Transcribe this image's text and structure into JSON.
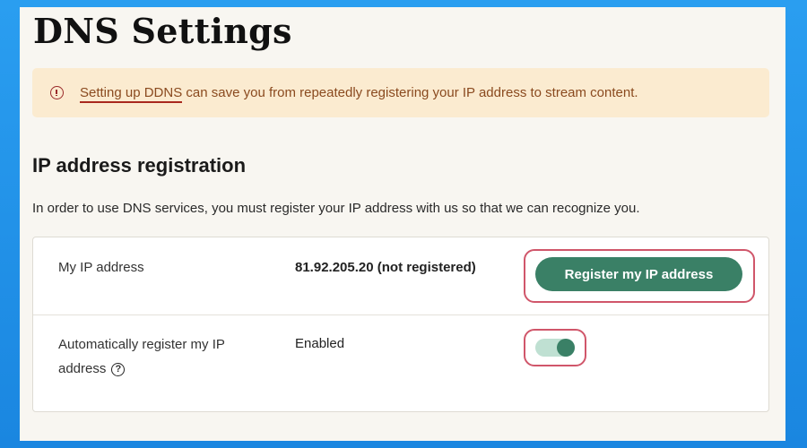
{
  "page": {
    "title": "DNS Settings"
  },
  "notice": {
    "icon": "alert-circle-icon",
    "link_text": "Setting up DDNS",
    "text": " can save you from repeatedly registering your IP address to stream content."
  },
  "section": {
    "title": "IP address registration",
    "description": "In order to use DNS services, you must register your IP address with us so that we can recognize you."
  },
  "rows": [
    {
      "label": "My IP address",
      "value": "81.92.205.20 (not registered)",
      "action_label": "Register my IP address"
    },
    {
      "label": "Automatically register my IP address",
      "help_icon": "?",
      "value": "Enabled",
      "toggle_state": "on"
    }
  ],
  "colors": {
    "accent": "#3a8066",
    "highlight": "#d0566a",
    "notice_bg": "#fbebd0"
  }
}
